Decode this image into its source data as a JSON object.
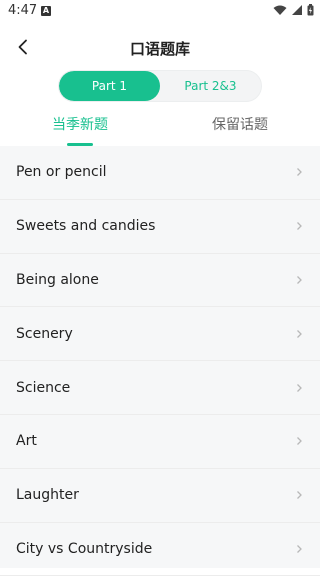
{
  "status_bar": {
    "time": "4:47",
    "notification_letter": "A",
    "icons": [
      "wifi-icon",
      "signal-icon",
      "battery-icon"
    ]
  },
  "header": {
    "title": "口语题库",
    "back_icon": "chevron-left-icon"
  },
  "segments": [
    {
      "label": "Part 1",
      "selected": true
    },
    {
      "label": "Part 2&3",
      "selected": false
    }
  ],
  "tabs": [
    {
      "label": "当季新题",
      "selected": true
    },
    {
      "label": "保留话题",
      "selected": false
    }
  ],
  "topics": [
    {
      "label": "Pen or pencil"
    },
    {
      "label": "Sweets and candies"
    },
    {
      "label": "Being alone"
    },
    {
      "label": "Scenery"
    },
    {
      "label": "Science"
    },
    {
      "label": "Art"
    },
    {
      "label": "Laughter"
    },
    {
      "label": "City vs Countryside"
    }
  ],
  "colors": {
    "accent": "#18c08f",
    "list_bg": "#f6f7f8",
    "chevron": "#b8b8b8"
  }
}
